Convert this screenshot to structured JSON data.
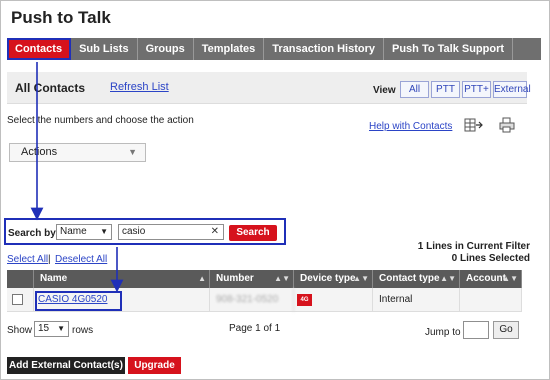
{
  "app": {
    "title": "Push to Talk"
  },
  "tabs": [
    {
      "label": "Contacts",
      "active": true
    },
    {
      "label": "Sub Lists"
    },
    {
      "label": "Groups"
    },
    {
      "label": "Templates"
    },
    {
      "label": "Transaction History"
    },
    {
      "label": "Push To Talk Support"
    }
  ],
  "panel": {
    "title": "All Contacts",
    "refresh": "Refresh List",
    "view_label": "View",
    "view_options": [
      "All",
      "PTT",
      "PTT+",
      "External"
    ]
  },
  "instructions": "Select the numbers and choose the action",
  "help_link": "Help with Contacts",
  "actions": {
    "label": "Actions"
  },
  "search": {
    "label": "Search by",
    "field": "Name",
    "value": "casio",
    "button": "Search"
  },
  "results": {
    "lines_in_filter": "1 Lines in Current Filter",
    "lines_selected": "0 Lines Selected"
  },
  "selection": {
    "select_all": "Select All",
    "separator": "|",
    "deselect_all": "Deselect All"
  },
  "table": {
    "columns": [
      "Name",
      "Number",
      "Device type",
      "Contact type",
      "Account"
    ],
    "rows": [
      {
        "name": "CASIO 4G0520",
        "number": "908-321-0520",
        "device_badge": "4G",
        "contact_type": "Internal",
        "account": ""
      }
    ]
  },
  "pager": {
    "show": "Show",
    "rows_per_page": "15",
    "rows": "rows",
    "page_info": "Page 1 of 1",
    "jump_to": "Jump to",
    "go": "Go"
  },
  "footer": {
    "add_external": "Add External Contact(s)",
    "upgrade": "Upgrade"
  },
  "colors": {
    "accent_red": "#d6121c",
    "highlight_blue": "#1f2fb8",
    "link_blue": "#2b44c6"
  }
}
